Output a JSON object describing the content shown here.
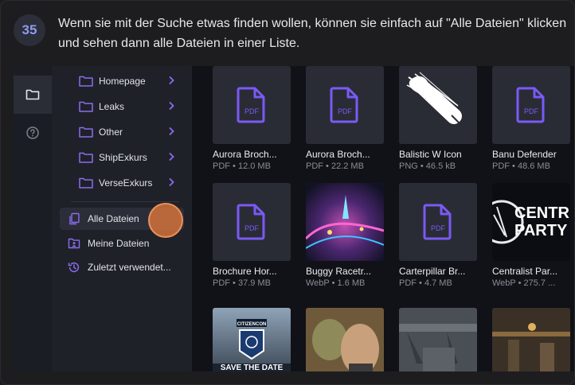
{
  "step": {
    "number": "35",
    "text": "Wenn sie mit der Suche etwas finden wollen, können sie einfach auf \"Alle Dateien\" klicken und sehen dann alle Dateien in einer Liste."
  },
  "rail": {
    "items": [
      {
        "icon": "folder-icon"
      },
      {
        "icon": "help-circle-icon"
      }
    ]
  },
  "sidebar": {
    "folders": [
      {
        "label": "Homepage"
      },
      {
        "label": "Leaks"
      },
      {
        "label": "Other"
      },
      {
        "label": "ShipExkurs"
      },
      {
        "label": "VerseExkurs"
      }
    ],
    "nav": [
      {
        "label": "Alle Dateien",
        "icon": "files-icon",
        "active": true
      },
      {
        "label": "Meine Dateien",
        "icon": "user-folder-icon"
      },
      {
        "label": "Zuletzt verwendet...",
        "icon": "history-icon"
      }
    ]
  },
  "files": [
    {
      "name": "Aurora Broch...",
      "meta": "PDF • 12.0 MB",
      "kind": "pdf"
    },
    {
      "name": "Aurora Broch...",
      "meta": "PDF • 22.2 MB",
      "kind": "pdf"
    },
    {
      "name": "Balistic W Icon",
      "meta": "PNG • 46.5 kB",
      "kind": "image"
    },
    {
      "name": "Banu Defender",
      "meta": "PDF • 48.6 MB",
      "kind": "pdf"
    },
    {
      "name": "Brochure Hor...",
      "meta": "PDF • 37.9 MB",
      "kind": "pdf"
    },
    {
      "name": "Buggy Racetr...",
      "meta": "WebP • 1.6 MB",
      "kind": "image"
    },
    {
      "name": "Carterpillar Br...",
      "meta": "PDF • 4.7 MB",
      "kind": "pdf"
    },
    {
      "name": "Centralist Par...",
      "meta": "WebP • 275.7 ...",
      "kind": "image"
    },
    {
      "name": "",
      "meta": "",
      "kind": "image"
    },
    {
      "name": "",
      "meta": "",
      "kind": "image"
    },
    {
      "name": "",
      "meta": "",
      "kind": "image"
    },
    {
      "name": "",
      "meta": "",
      "kind": "image"
    }
  ],
  "thumb_text": {
    "pdf": "PDF",
    "party_1": "CENTR",
    "party_2": "PARTY",
    "cc_logo": "CITIZENCON",
    "save_date": "SAVE THE DATE"
  },
  "colors": {
    "accent": "#8b6cf0",
    "pdf_icon": "#7a5af5",
    "click_marker": "#e2783e"
  }
}
